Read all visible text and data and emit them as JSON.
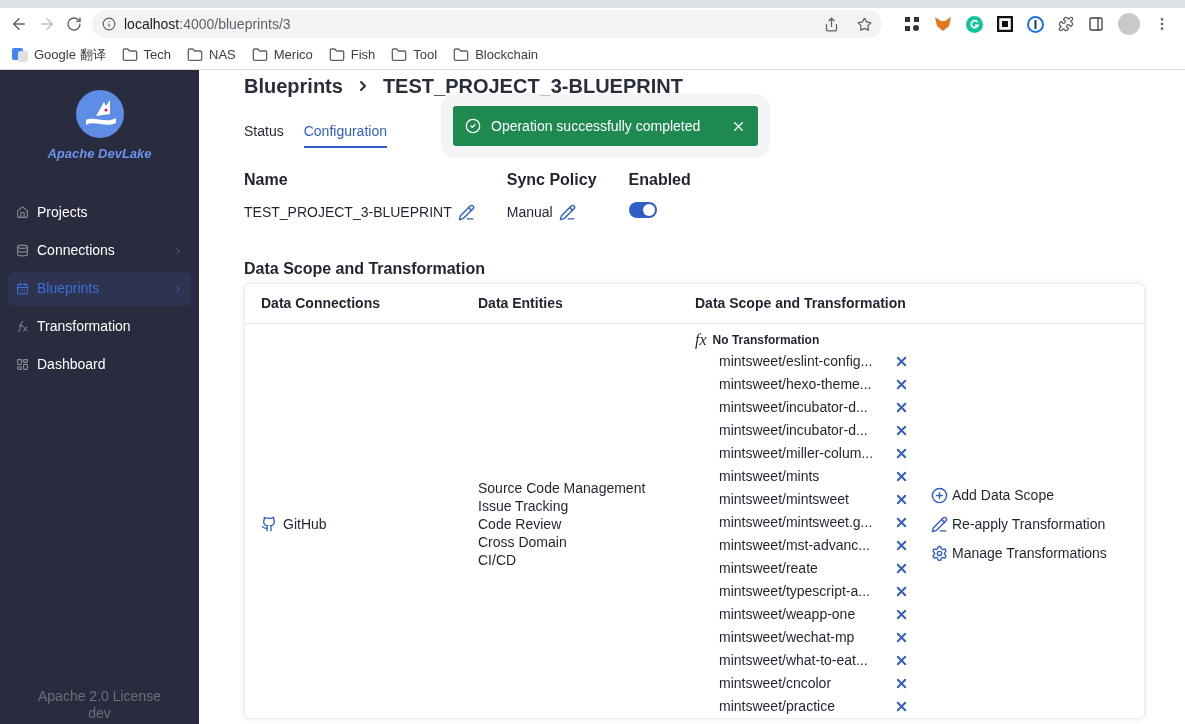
{
  "browser": {
    "url_host": "localhost",
    "url_rest": ":4000/blueprints/3",
    "bookmarks": [
      {
        "kind": "translate",
        "label": "Google 翻译"
      },
      {
        "kind": "folder",
        "label": "Tech"
      },
      {
        "kind": "folder",
        "label": "NAS"
      },
      {
        "kind": "folder",
        "label": "Merico"
      },
      {
        "kind": "folder",
        "label": "Fish"
      },
      {
        "kind": "folder",
        "label": "Tool"
      },
      {
        "kind": "folder",
        "label": "Blockchain"
      }
    ]
  },
  "sidebar": {
    "brand": "Apache DevLake",
    "items": [
      {
        "kind": "home",
        "label": "Projects",
        "selected": false,
        "submenu": false
      },
      {
        "kind": "db",
        "label": "Connections",
        "selected": false,
        "submenu": true
      },
      {
        "kind": "calendar",
        "label": "Blueprints",
        "selected": true,
        "submenu": true
      },
      {
        "kind": "fx",
        "label": "Transformation",
        "selected": false,
        "submenu": false
      },
      {
        "kind": "dashboard",
        "label": "Dashboard",
        "selected": false,
        "submenu": false
      }
    ],
    "footer": [
      "Apache 2.0 License",
      "dev"
    ]
  },
  "breadcrumb": [
    "Blueprints",
    "TEST_PROJECT_3-BLUEPRINT"
  ],
  "toast": {
    "message": "Operation successfully completed"
  },
  "tabs": [
    {
      "label": "Status",
      "selected": false
    },
    {
      "label": "Configuration",
      "selected": true
    }
  ],
  "fields": [
    {
      "kind": "editable",
      "label": "Name",
      "value": "TEST_PROJECT_3-BLUEPRINT"
    },
    {
      "kind": "editable",
      "label": "Sync Policy",
      "value": "Manual"
    },
    {
      "kind": "toggle",
      "label": "Enabled",
      "on": true
    }
  ],
  "section_title": "Data Scope and Transformation",
  "table": {
    "columns": [
      "Data Connections",
      "Data Entities",
      "Data Scope and Transformation"
    ],
    "row": {
      "connection": "GitHub",
      "entities": [
        "Source Code Management",
        "Issue Tracking",
        "Code Review",
        "Cross Domain",
        "CI/CD"
      ],
      "transformation_icon": "fx",
      "transformation": "No Transformation",
      "scopes": [
        "mintsweet/eslint-config...",
        "mintsweet/hexo-theme...",
        "mintsweet/incubator-d...",
        "mintsweet/incubator-d...",
        "mintsweet/miller-colum...",
        "mintsweet/mints",
        "mintsweet/mintsweet",
        "mintsweet/mintsweet.g...",
        "mintsweet/mst-advanc...",
        "mintsweet/reate",
        "mintsweet/typescript-a...",
        "mintsweet/weapp-one",
        "mintsweet/wechat-mp",
        "mintsweet/what-to-eat...",
        "mintsweet/cncolor",
        "mintsweet/practice"
      ],
      "actions": [
        {
          "kind": "add",
          "label": "Add Data Scope"
        },
        {
          "kind": "edit",
          "label": "Re-apply Transformation"
        },
        {
          "kind": "gear",
          "label": "Manage Transformations"
        }
      ]
    }
  }
}
